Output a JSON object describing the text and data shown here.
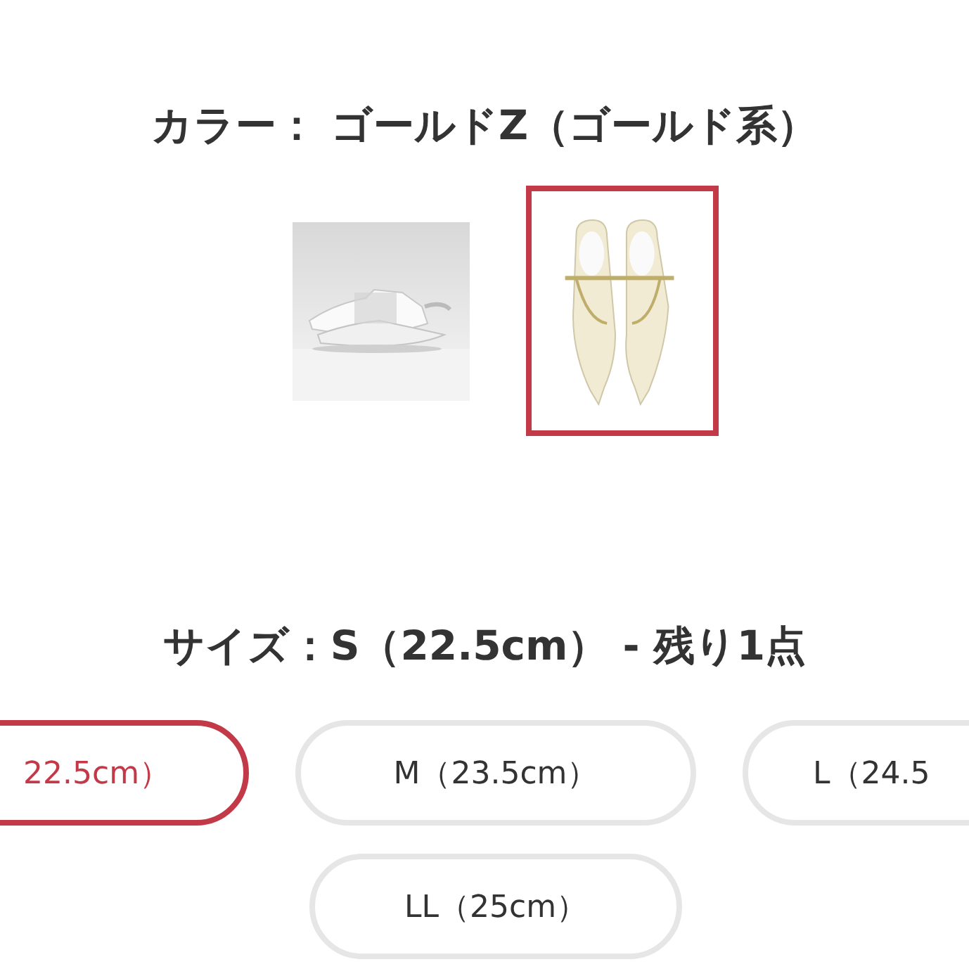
{
  "color": {
    "heading": "カラー： ゴールドZ（ゴールド系）",
    "swatches": [
      {
        "kind": "picture",
        "selected": false
      },
      {
        "kind": "picture",
        "selected": true
      }
    ]
  },
  "size": {
    "heading": "サイズ：S（22.5cm） - 残り1点",
    "options": [
      {
        "label": "22.5cm）",
        "selected": true
      },
      {
        "label": "M（23.5cm）",
        "selected": false
      },
      {
        "label": "L（24.5",
        "selected": false
      },
      {
        "label": "LL（25cm）",
        "selected": false
      }
    ]
  }
}
